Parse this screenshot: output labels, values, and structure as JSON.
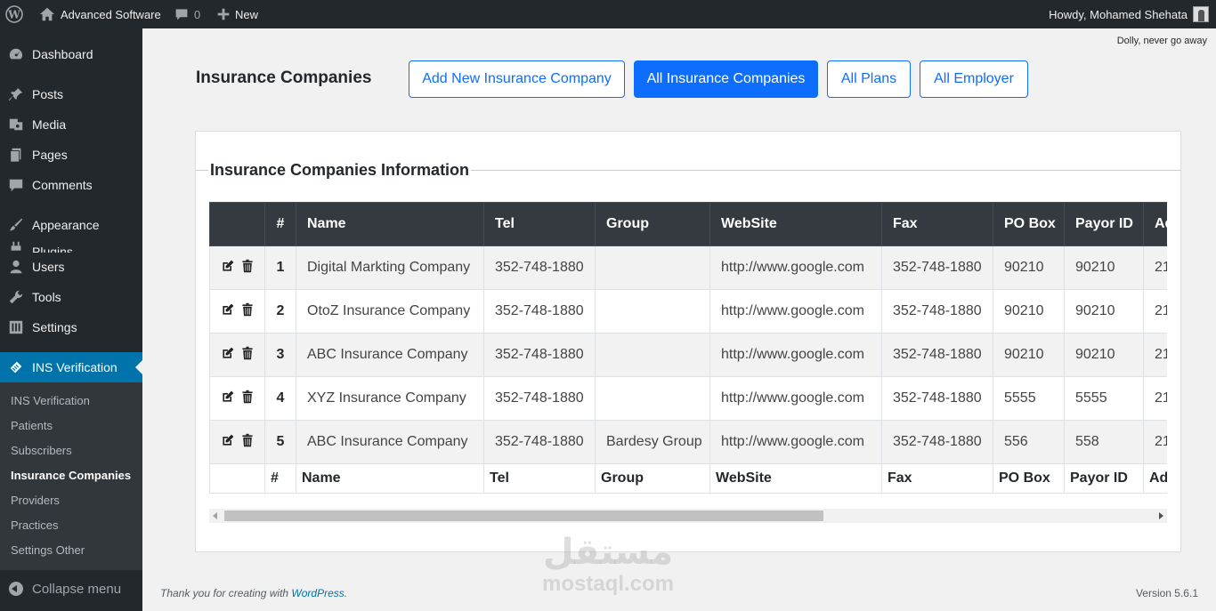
{
  "adminbar": {
    "site_name": "Advanced Software",
    "comments_count": "0",
    "new_label": "New",
    "howdy": "Howdy, Mohamed Shehata"
  },
  "sidebar": {
    "items": [
      {
        "label": "Dashboard",
        "icon": "dashboard-icon"
      },
      {
        "label": "Posts",
        "icon": "pin-icon"
      },
      {
        "label": "Media",
        "icon": "media-icon"
      },
      {
        "label": "Pages",
        "icon": "pages-icon"
      },
      {
        "label": "Comments",
        "icon": "comment-icon"
      },
      {
        "label": "Appearance",
        "icon": "brush-icon"
      },
      {
        "label": "Plugins",
        "icon": "plugin-icon"
      },
      {
        "label": "Users",
        "icon": "user-icon"
      },
      {
        "label": "Tools",
        "icon": "wrench-icon"
      },
      {
        "label": "Settings",
        "icon": "sliders-icon"
      },
      {
        "label": "INS Verification",
        "icon": "tag-icon"
      }
    ],
    "submenu": [
      "INS Verification",
      "Patients",
      "Subscribers",
      "Insurance Companies",
      "Providers",
      "Practices",
      "Settings Other"
    ],
    "collapse_label": "Collapse menu"
  },
  "dolly": "Dolly, never go away",
  "page": {
    "title": "Insurance Companies",
    "buttons": [
      "Add New Insurance Company",
      "All Insurance Companies",
      "All Plans",
      "All Employer"
    ]
  },
  "card": {
    "legend": "Insurance Companies Information"
  },
  "table": {
    "headers": [
      "",
      "#",
      "Name",
      "Tel",
      "Group",
      "WebSite",
      "Fax",
      "PO Box",
      "Payor ID",
      "Address"
    ],
    "rows": [
      [
        "1",
        "Digital Markting Company",
        "352-748-1880",
        "",
        "http://www.google.com",
        "352-748-1880",
        "90210",
        "90210",
        "21"
      ],
      [
        "2",
        "OtoZ Insurance Company",
        "352-748-1880",
        "",
        "http://www.google.com",
        "352-748-1880",
        "90210",
        "90210",
        "21"
      ],
      [
        "3",
        "ABC Insurance Company",
        "352-748-1880",
        "",
        "http://www.google.com",
        "352-748-1880",
        "90210",
        "90210",
        "21"
      ],
      [
        "4",
        "XYZ Insurance Company",
        "352-748-1880",
        "",
        "http://www.google.com",
        "352-748-1880",
        "5555",
        "5555",
        "21"
      ],
      [
        "5",
        "ABC Insurance Company",
        "352-748-1880",
        "Bardesy Group",
        "http://www.google.com",
        "352-748-1880",
        "556",
        "558",
        "21"
      ]
    ],
    "footer": [
      "",
      "#",
      "Name",
      "Tel",
      "Group",
      "WebSite",
      "Fax",
      "PO Box",
      "Payor ID",
      "Address"
    ],
    "scroll_fraction_visible": 0.63
  },
  "footer": {
    "thanks_prefix": "Thank you for creating with ",
    "thanks_link": "WordPress",
    "thanks_suffix": ".",
    "version": "Version 5.6.1"
  },
  "watermark": {
    "arabic": "مستقل",
    "latin": "mostaql.com"
  }
}
